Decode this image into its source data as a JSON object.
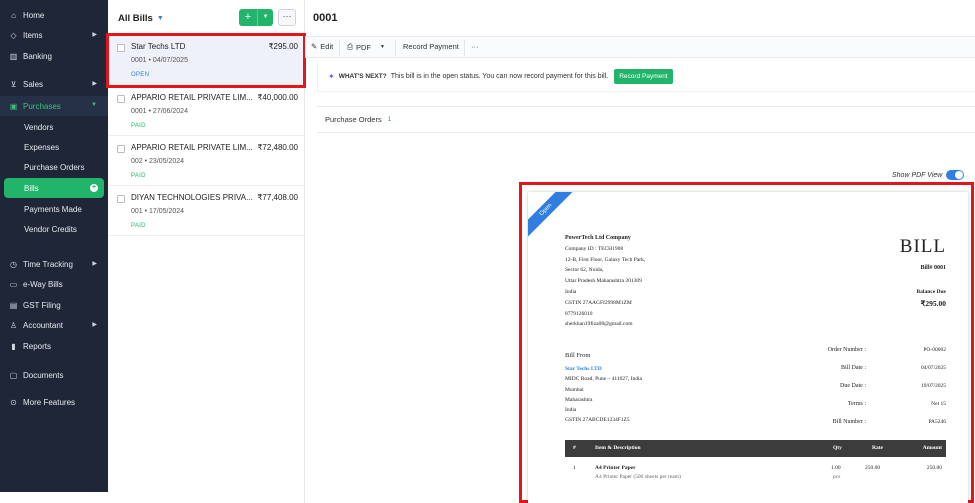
{
  "sidebar": {
    "items": [
      {
        "label": "Home",
        "icon": "home-icon",
        "glyph": "⌂"
      },
      {
        "label": "Items",
        "icon": "tag-icon",
        "glyph": "◇"
      },
      {
        "label": "Banking",
        "icon": "bank-icon",
        "glyph": "▥"
      },
      {
        "label": "Sales",
        "icon": "cart-icon",
        "glyph": "⊻"
      },
      {
        "label": "Purchases",
        "icon": "bag-icon",
        "glyph": "▣"
      },
      {
        "label": "Vendors"
      },
      {
        "label": "Expenses"
      },
      {
        "label": "Purchase Orders"
      },
      {
        "label": "Bills"
      },
      {
        "label": "Payments Made"
      },
      {
        "label": "Vendor Credits"
      },
      {
        "label": "Time Tracking",
        "icon": "clock-icon",
        "glyph": "◷"
      },
      {
        "label": "e-Way Bills",
        "icon": "truck-icon",
        "glyph": "▭"
      },
      {
        "label": "GST Filing",
        "icon": "file-icon",
        "glyph": "▤"
      },
      {
        "label": "Accountant",
        "icon": "user-icon",
        "glyph": "♙"
      },
      {
        "label": "Reports",
        "icon": "bar-chart-icon",
        "glyph": "▮"
      },
      {
        "label": "Documents",
        "icon": "folder-icon",
        "glyph": "▢"
      },
      {
        "label": "More Features",
        "icon": "more-icon",
        "glyph": "⊙"
      }
    ]
  },
  "list": {
    "title": "All Bills",
    "bills": [
      {
        "name": "Star Techs LTD",
        "amount": "₹295.00",
        "number": "0001",
        "date": "04/07/2025",
        "status": "OPEN"
      },
      {
        "name": "APPARIO RETAIL PRIVATE LIM...",
        "amount": "₹40,000.00",
        "number": "0001",
        "date": "27/06/2024",
        "status": "PAID"
      },
      {
        "name": "APPARIO RETAIL PRIVATE LIM...",
        "amount": "₹72,480.00",
        "number": "002",
        "date": "23/05/2024",
        "status": "PAID"
      },
      {
        "name": "DIYAN TECHNOLOGIES PRIVA...",
        "amount": "₹77,408.00",
        "number": "001",
        "date": "17/05/2024",
        "status": "PAID"
      }
    ]
  },
  "detail": {
    "title": "0001",
    "toolbar": {
      "edit": "Edit",
      "pdf": "PDF",
      "record_payment": "Record Payment"
    },
    "banner": {
      "label": "WHAT'S NEXT?",
      "text": "This bill is in the open status. You can now record payment for this bill.",
      "button": "Record Payment"
    },
    "purchase_orders": {
      "label": "Purchase Orders",
      "count": "1"
    },
    "pdf_toggle": "Show PDF View"
  },
  "pdf": {
    "ribbon": "Open",
    "company": {
      "name": "PowerTech Ltd Company",
      "lines": [
        "Company ID : TECH1908",
        "12-B, First Floor, Galaxy Tech Park,",
        "Sector 62, Noida,",
        "Uttar Pradesh Maharashtra 201309",
        "India",
        "GSTIN 27AAGFI2998M1ZM",
        "8779126010",
        "sherkhan19fiza08@gmail.com"
      ]
    },
    "heading": "BILL",
    "bill_no": "Bill# 0001",
    "balance_label": "Balance Due",
    "balance_amount": "₹295.00",
    "bill_from": {
      "label": "Bill From",
      "vendor": "Star Techs LTD",
      "lines": [
        "MIDC Road, Pune – 411027, India",
        "Mumbai",
        "Maharashtra",
        "India",
        "GSTIN 27ABCDE1234F1Z5"
      ]
    },
    "meta": [
      {
        "k": "Order Number :",
        "v": "PO-00002"
      },
      {
        "k": "Bill Date :",
        "v": "04/07/2025"
      },
      {
        "k": "Due Date :",
        "v": "19/07/2025"
      },
      {
        "k": "Terms :",
        "v": "Net 15"
      },
      {
        "k": "Bill Number :",
        "v": "PA5246"
      }
    ],
    "items_header": {
      "num": "#",
      "desc": "Item & Description",
      "qty": "Qty",
      "rate": "Rate",
      "amount": "Amount"
    },
    "items": [
      {
        "num": "1",
        "name": "A4 Printer Paper",
        "desc": "A4 Printer Paper (500 sheets per ream)",
        "qty": "1.00",
        "unit": "pcs",
        "rate": "250.00",
        "amount": "250.00"
      }
    ]
  }
}
